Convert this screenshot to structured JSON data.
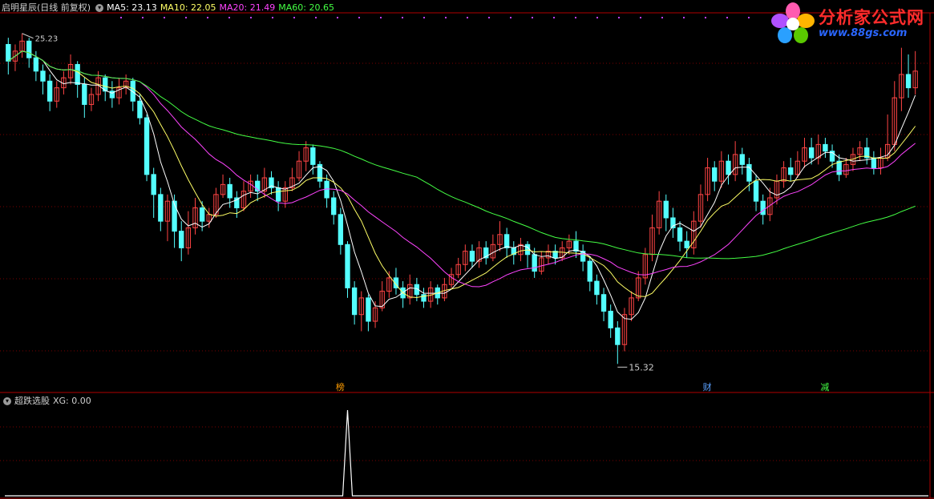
{
  "main_panel": {
    "title": "启明星辰(日线 前复权)",
    "ma_labels": [
      {
        "text": "MA5: 23.13",
        "color": "#ffffff"
      },
      {
        "text": "MA10: 22.05",
        "color": "#ffff66"
      },
      {
        "text": "MA20: 21.49",
        "color": "#ff44ff"
      },
      {
        "text": "MA60: 20.65",
        "color": "#44ff44"
      }
    ],
    "high_label": "25.23",
    "low_label": "15.32",
    "markers": [
      {
        "text": "榜",
        "color": "#ff9c00"
      },
      {
        "text": "财",
        "color": "#5aa0ff"
      },
      {
        "text": "减",
        "color": "#44ff44"
      }
    ]
  },
  "sub_panel": {
    "title": "超跌选股",
    "value_label": "XG: 0.00"
  },
  "logo": {
    "name": "分析家公式网",
    "url": "www.88gs.com"
  },
  "colors": {
    "background": "#000000",
    "up_candle": "#ff4444",
    "down_candle": "#54ffff",
    "grid": "#7a0000",
    "border": "#b00000",
    "ma5": "#ffffff",
    "ma10": "#ffff66",
    "ma20": "#ff44ff",
    "ma60": "#44ff44"
  },
  "chart_data": [
    {
      "type": "candlestick",
      "grid": true,
      "ylim": [
        14.8,
        25.8
      ],
      "candles": [
        [
          24.9,
          24.4,
          25.1,
          24.0
        ],
        [
          24.4,
          24.7,
          24.9,
          24.1
        ],
        [
          24.7,
          25.0,
          25.23,
          24.5
        ],
        [
          25.0,
          24.5,
          25.1,
          24.2
        ],
        [
          24.5,
          24.1,
          24.7,
          23.8
        ],
        [
          24.1,
          23.8,
          24.3,
          23.4
        ],
        [
          23.8,
          23.2,
          24.0,
          22.9
        ],
        [
          23.2,
          23.6,
          23.8,
          23.0
        ],
        [
          23.6,
          23.9,
          24.1,
          23.4
        ],
        [
          23.9,
          24.3,
          24.6,
          23.7
        ],
        [
          24.3,
          23.7,
          24.4,
          23.3
        ],
        [
          23.7,
          23.1,
          23.9,
          22.7
        ],
        [
          23.1,
          23.4,
          23.6,
          22.9
        ],
        [
          23.4,
          23.9,
          24.1,
          23.2
        ],
        [
          23.9,
          23.5,
          24.0,
          23.2
        ],
        [
          23.5,
          23.3,
          23.8,
          23.0
        ],
        [
          23.3,
          23.6,
          23.9,
          23.1
        ],
        [
          23.6,
          23.8,
          24.0,
          23.4
        ],
        [
          23.8,
          23.2,
          23.9,
          22.9
        ],
        [
          23.2,
          22.7,
          23.4,
          22.5
        ],
        [
          22.7,
          21.0,
          22.8,
          20.8
        ],
        [
          21.0,
          20.4,
          21.2,
          19.7
        ],
        [
          20.4,
          19.6,
          20.6,
          19.3
        ],
        [
          19.6,
          20.2,
          20.4,
          19.0
        ],
        [
          20.2,
          19.3,
          20.4,
          18.8
        ],
        [
          19.3,
          18.8,
          19.6,
          18.4
        ],
        [
          18.8,
          19.4,
          19.9,
          18.6
        ],
        [
          19.4,
          20.0,
          20.3,
          19.2
        ],
        [
          20.0,
          19.6,
          20.2,
          19.3
        ],
        [
          19.6,
          19.8,
          20.0,
          19.4
        ],
        [
          19.8,
          20.4,
          20.6,
          19.7
        ],
        [
          20.4,
          20.7,
          21.0,
          20.3
        ],
        [
          20.7,
          20.3,
          20.9,
          20.0
        ],
        [
          20.3,
          20.0,
          20.5,
          19.7
        ],
        [
          20.0,
          20.5,
          20.8,
          19.9
        ],
        [
          20.5,
          20.8,
          21.0,
          20.3
        ],
        [
          20.8,
          20.5,
          21.0,
          20.2
        ],
        [
          20.5,
          20.9,
          21.2,
          20.3
        ],
        [
          20.9,
          20.6,
          21.1,
          20.4
        ],
        [
          20.6,
          20.2,
          20.8,
          19.9
        ],
        [
          20.2,
          20.6,
          20.8,
          20.0
        ],
        [
          20.6,
          20.9,
          21.2,
          20.5
        ],
        [
          20.9,
          21.4,
          21.7,
          20.8
        ],
        [
          21.4,
          21.8,
          22.0,
          21.1
        ],
        [
          21.8,
          21.3,
          21.9,
          21.0
        ],
        [
          21.3,
          20.8,
          21.4,
          20.6
        ],
        [
          20.8,
          20.3,
          21.0,
          20.0
        ],
        [
          20.3,
          19.8,
          20.5,
          19.5
        ],
        [
          19.8,
          18.9,
          20.0,
          18.6
        ],
        [
          18.9,
          17.6,
          19.0,
          17.3
        ],
        [
          17.6,
          16.8,
          17.8,
          16.5
        ],
        [
          16.8,
          17.3,
          17.5,
          16.3
        ],
        [
          17.3,
          16.6,
          17.4,
          16.3
        ],
        [
          16.6,
          17.0,
          17.2,
          16.4
        ],
        [
          17.0,
          17.5,
          17.8,
          16.9
        ],
        [
          17.5,
          17.9,
          18.1,
          17.3
        ],
        [
          17.9,
          17.6,
          18.2,
          17.4
        ],
        [
          17.6,
          17.3,
          17.8,
          17.0
        ],
        [
          17.3,
          17.7,
          18.0,
          17.1
        ],
        [
          17.7,
          17.4,
          17.9,
          17.2
        ],
        [
          17.4,
          17.2,
          17.6,
          17.0
        ],
        [
          17.2,
          17.6,
          17.8,
          17.0
        ],
        [
          17.6,
          17.3,
          17.7,
          17.1
        ],
        [
          17.3,
          17.7,
          17.9,
          17.2
        ],
        [
          17.7,
          18.0,
          18.2,
          17.6
        ],
        [
          18.0,
          18.3,
          18.5,
          17.9
        ],
        [
          18.3,
          18.7,
          18.9,
          18.1
        ],
        [
          18.7,
          18.4,
          18.9,
          18.2
        ],
        [
          18.4,
          18.8,
          19.0,
          18.2
        ],
        [
          18.8,
          18.5,
          19.0,
          18.3
        ],
        [
          18.5,
          18.9,
          19.2,
          18.4
        ],
        [
          18.9,
          19.2,
          19.6,
          18.7
        ],
        [
          19.2,
          18.8,
          19.4,
          18.5
        ],
        [
          18.8,
          18.6,
          19.0,
          18.3
        ],
        [
          18.6,
          18.9,
          19.1,
          18.4
        ],
        [
          18.9,
          18.6,
          19.0,
          18.2
        ],
        [
          18.6,
          18.1,
          18.8,
          17.9
        ],
        [
          18.1,
          18.5,
          18.7,
          18.0
        ],
        [
          18.5,
          18.7,
          18.9,
          18.3
        ],
        [
          18.7,
          18.5,
          18.9,
          18.3
        ],
        [
          18.5,
          18.8,
          19.0,
          18.4
        ],
        [
          18.8,
          19.0,
          19.2,
          18.6
        ],
        [
          19.0,
          18.7,
          19.3,
          18.5
        ],
        [
          18.7,
          18.4,
          18.9,
          18.1
        ],
        [
          18.4,
          17.8,
          18.5,
          17.5
        ],
        [
          17.8,
          17.4,
          18.0,
          17.1
        ],
        [
          17.4,
          16.9,
          17.6,
          16.6
        ],
        [
          16.9,
          16.4,
          17.1,
          16.1
        ],
        [
          16.4,
          15.9,
          16.6,
          15.32
        ],
        [
          15.9,
          16.8,
          17.0,
          15.7
        ],
        [
          16.8,
          17.3,
          17.5,
          16.6
        ],
        [
          17.3,
          17.9,
          18.1,
          17.2
        ],
        [
          17.9,
          18.6,
          18.8,
          17.7
        ],
        [
          18.6,
          19.4,
          19.8,
          18.4
        ],
        [
          19.4,
          20.2,
          20.5,
          19.2
        ],
        [
          20.2,
          19.7,
          20.4,
          19.3
        ],
        [
          19.7,
          19.4,
          20.0,
          19.1
        ],
        [
          19.4,
          19.0,
          19.6,
          18.7
        ],
        [
          19.0,
          18.8,
          19.3,
          18.5
        ],
        [
          18.8,
          19.6,
          19.9,
          18.6
        ],
        [
          19.6,
          20.4,
          20.7,
          19.4
        ],
        [
          20.4,
          21.2,
          21.5,
          20.2
        ],
        [
          21.2,
          20.8,
          21.4,
          20.5
        ],
        [
          20.8,
          21.4,
          21.7,
          20.6
        ],
        [
          21.4,
          21.0,
          21.6,
          20.7
        ],
        [
          21.0,
          21.6,
          22.0,
          20.8
        ],
        [
          21.6,
          21.3,
          21.8,
          21.0
        ],
        [
          21.3,
          20.8,
          21.5,
          20.5
        ],
        [
          20.8,
          20.2,
          21.0,
          19.9
        ],
        [
          20.2,
          19.8,
          20.4,
          19.5
        ],
        [
          19.8,
          20.3,
          20.6,
          19.6
        ],
        [
          20.3,
          20.8,
          21.0,
          20.1
        ],
        [
          20.8,
          21.2,
          21.4,
          20.6
        ],
        [
          21.2,
          21.0,
          21.5,
          20.8
        ],
        [
          21.0,
          21.4,
          21.7,
          20.9
        ],
        [
          21.4,
          21.8,
          22.1,
          21.2
        ],
        [
          21.8,
          21.5,
          22.1,
          21.3
        ],
        [
          21.5,
          21.9,
          22.2,
          21.3
        ],
        [
          21.9,
          21.7,
          22.1,
          21.5
        ],
        [
          21.7,
          21.4,
          21.9,
          21.2
        ],
        [
          21.4,
          21.0,
          21.6,
          20.8
        ],
        [
          21.0,
          21.3,
          21.5,
          20.9
        ],
        [
          21.3,
          21.6,
          21.8,
          21.1
        ],
        [
          21.6,
          21.8,
          22.0,
          21.4
        ],
        [
          21.8,
          21.5,
          22.1,
          21.3
        ],
        [
          21.5,
          21.2,
          21.7,
          21.0
        ],
        [
          21.2,
          21.5,
          21.8,
          21.0
        ],
        [
          21.5,
          21.9,
          22.8,
          21.4
        ],
        [
          21.9,
          23.3,
          23.8,
          21.7
        ],
        [
          23.3,
          24.0,
          24.8,
          22.9
        ],
        [
          24.0,
          23.6,
          24.6,
          23.3
        ],
        [
          23.6,
          24.1,
          24.7,
          23.4
        ]
      ],
      "ma_periods": [
        5,
        10,
        20,
        60
      ],
      "annotations": [
        "25.23",
        "15.32",
        "榜",
        "财",
        "减"
      ]
    },
    {
      "type": "line",
      "title": "超跌选股",
      "series": [
        {
          "name": "XG",
          "values_note_index": 49,
          "spike_value": 1,
          "base_value": 0
        }
      ],
      "ylim": [
        0,
        1.05
      ]
    }
  ]
}
